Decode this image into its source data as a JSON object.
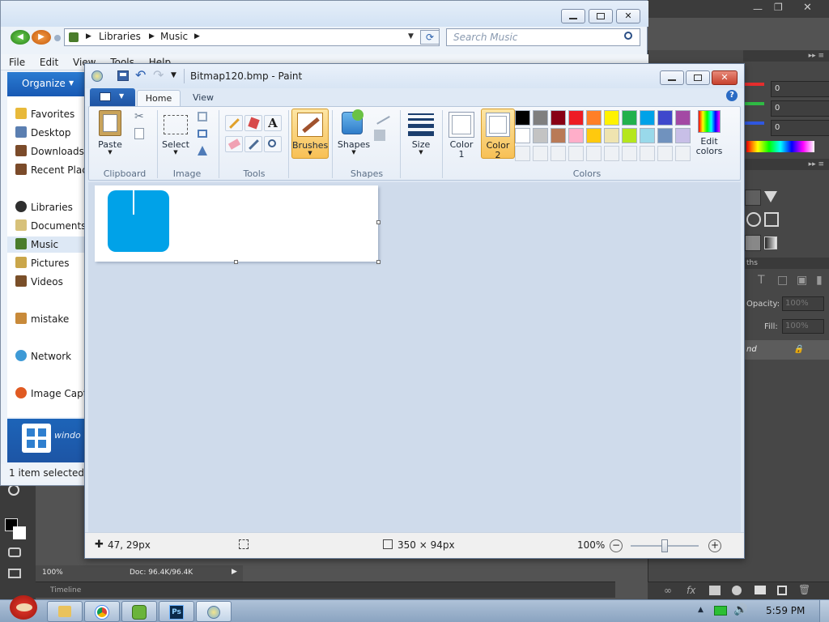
{
  "photoshop": {
    "channels": [
      {
        "label": "0",
        "color": "#e52d2d"
      },
      {
        "label": "0",
        "color": "#2fba44"
      },
      {
        "label": "0",
        "color": "#2f57e0"
      }
    ],
    "paths_tab": "ths",
    "opacity_label": "Opacity:",
    "opacity_value": "100%",
    "fill_label": "Fill:",
    "fill_value": "100%",
    "layer_name": "nd",
    "zoom": "100%",
    "doc_info": "Doc: 96.4K/96.4K",
    "timeline_label": "Timeline"
  },
  "explorer": {
    "breadcrumb": [
      "Libraries",
      "Music"
    ],
    "search_placeholder": "Search Music",
    "menu": [
      "File",
      "Edit",
      "View",
      "Tools",
      "Help"
    ],
    "organize_label": "Organize",
    "nav_items": [
      {
        "label": "Favorites",
        "icon": "star-icon",
        "color": "#e8b93a"
      },
      {
        "label": "Desktop",
        "icon": "desktop-icon",
        "color": "#5b7fb1"
      },
      {
        "label": "Downloads",
        "icon": "download-icon",
        "color": "#7b4b2a"
      },
      {
        "label": "Recent Places",
        "icon": "recent-icon",
        "color": "#7b4b2a"
      },
      {
        "label": "Libraries",
        "icon": "libraries-icon",
        "color": "#2f2f2f"
      },
      {
        "label": "Documents",
        "icon": "documents-icon",
        "color": "#d7c17a"
      },
      {
        "label": "Music",
        "icon": "music-icon",
        "color": "#4a7c2b"
      },
      {
        "label": "Pictures",
        "icon": "pictures-icon",
        "color": "#caa64a"
      },
      {
        "label": "Videos",
        "icon": "videos-icon",
        "color": "#7a4f29"
      },
      {
        "label": "mistake",
        "icon": "homegroup-icon",
        "color": "#c88a3a"
      },
      {
        "label": "Network",
        "icon": "network-icon",
        "color": "#3e9ad6"
      },
      {
        "label": "Image Capture",
        "icon": "image-capture-icon",
        "color": "#e05a22"
      }
    ],
    "details_text": "windo",
    "status": "1 item selected"
  },
  "paint": {
    "title": "Bitmap120.bmp - Paint",
    "tabs": [
      "Home",
      "View"
    ],
    "groups": {
      "clipboard": "Clipboard",
      "image": "Image",
      "tools": "Tools",
      "shapes": "Shapes",
      "colors": "Colors"
    },
    "buttons": {
      "paste": "Paste",
      "select": "Select",
      "brushes": "Brushes",
      "shapes": "Shapes",
      "size": "Size",
      "color1_a": "Color",
      "color1_b": "1",
      "color2_a": "Color",
      "color2_b": "2",
      "edit_a": "Edit",
      "edit_b": "colors"
    },
    "color1": "#ffffff",
    "color2": "#ffffff",
    "palette": [
      "#000000",
      "#7f7f7f",
      "#880015",
      "#ed1c24",
      "#ff7f27",
      "#fff200",
      "#22b14c",
      "#00a2e8",
      "#3f48cc",
      "#a349a4",
      "#ffffff",
      "#c3c3c3",
      "#b97a57",
      "#ffaec9",
      "#ffc90e",
      "#efe4b0",
      "#b5e61d",
      "#99d9ea",
      "#7092be",
      "#c8bfe7"
    ],
    "status": {
      "cursor": "47, 29px",
      "selection": "",
      "size": "350 × 94px",
      "zoom": "100%"
    },
    "zoom_level": 0.5,
    "shape_fill": "#00a2e8"
  },
  "taskbar": {
    "apps": [
      {
        "name": "explorer-icon",
        "label": ""
      },
      {
        "name": "chrome-icon",
        "label": ""
      },
      {
        "name": "game-icon",
        "label": ""
      },
      {
        "name": "photoshop-icon",
        "label": "Ps"
      },
      {
        "name": "paint-icon",
        "label": ""
      }
    ],
    "clock": "5:59 PM"
  }
}
